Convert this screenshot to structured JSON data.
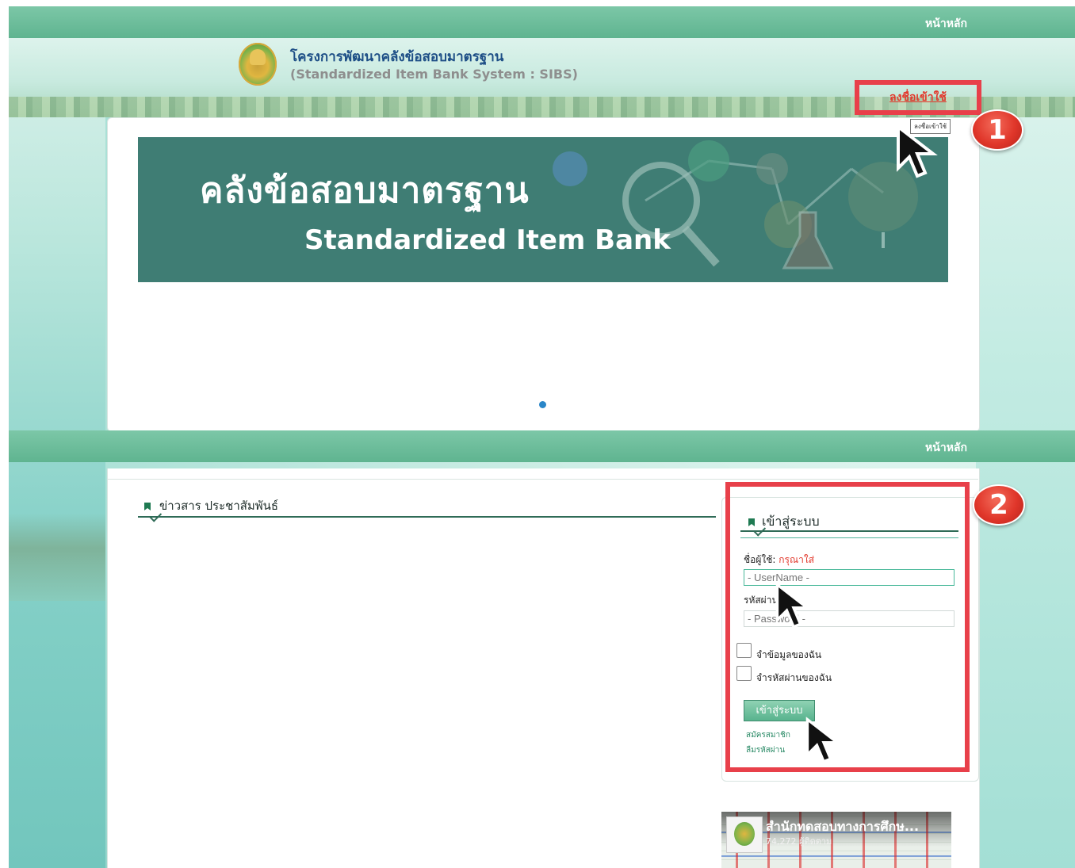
{
  "nav": {
    "home_label": "หน้าหลัก"
  },
  "header": {
    "title_th": "โครงการพัฒนาคลังข้อสอบมาตรฐาน",
    "title_en": "(Standardized Item Bank System : SIBS)",
    "login_link": "ลงชื่อเข้าใช้",
    "tooltip": "ลงชื่อเข้าใช้"
  },
  "banner": {
    "title_th": "คลังข้อสอบมาตรฐาน",
    "title_en": "Standardized Item Bank"
  },
  "annotations": {
    "step1": "1",
    "step2": "2"
  },
  "news": {
    "title": "ข่าวสาร ประชาสัมพันธ์"
  },
  "login": {
    "title": "เข้าสู่ระบบ",
    "username_label": "ชื่อผู้ใช้:",
    "username_required": "กรุณาใส่",
    "username_placeholder": "- UserName -",
    "password_label": "รหัสผ่าน",
    "password_placeholder": "- Password -",
    "remember_me": "จำข้อมูลของฉัน",
    "remember_password": "จำรหัสผ่านของฉัน",
    "submit": "เข้าสู่ระบบ",
    "register": "สมัครสมาชิก",
    "forgot": "ลืมรหัสผ่าน"
  },
  "facebook": {
    "page_name": "สำนักทดสอบทางการศึกษ...",
    "followers": "74,272 ผู้ติดตาม"
  },
  "colors": {
    "nav": "#6bbd9b",
    "banner": "#3f7d74",
    "highlight": "#e8404a",
    "title_blue": "#1d4e86"
  }
}
